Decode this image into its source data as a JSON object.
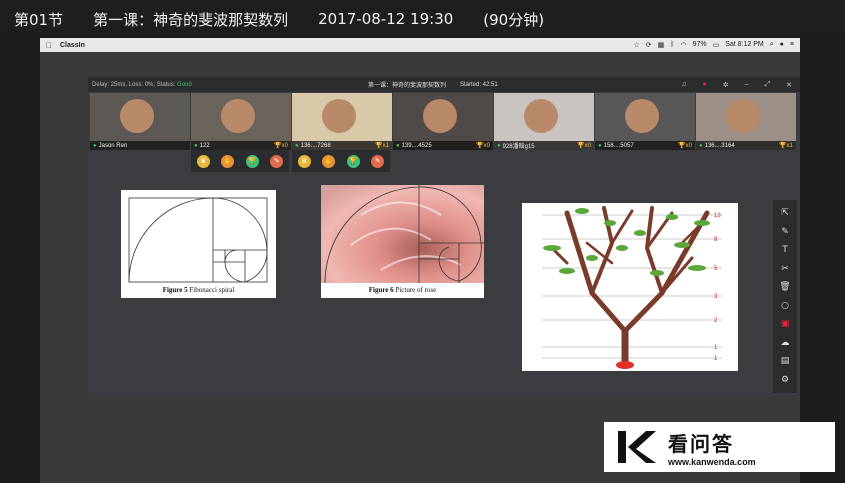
{
  "banner": {
    "lesson_no": "第01节",
    "lesson_title": "第一课：神奇的斐波那契数列",
    "datetime": "2017-08-12 19:30",
    "duration": "(90分钟)"
  },
  "macbar": {
    "app_name": "ClassIn",
    "battery": "97%",
    "clock": "Sat 8:12 PM"
  },
  "classin": {
    "status_prefix": "Delay: 25ms, Loss: 0%, Status: ",
    "status_value": "Good",
    "title": "第一课：神奇的斐波那契数列",
    "started": "Started: 42:51"
  },
  "videos": [
    {
      "name": "Jason Ren",
      "trophy": ""
    },
    {
      "name": "122",
      "trophy": "x0"
    },
    {
      "name": "136....7268",
      "trophy": "x1"
    },
    {
      "name": "139....4525",
      "trophy": "x0"
    },
    {
      "name": "928潘晗g15",
      "trophy": "x0"
    },
    {
      "name": "158....5057",
      "trophy": "x0"
    },
    {
      "name": "136....3164",
      "trophy": "x1"
    }
  ],
  "figures": {
    "fig5_label": "Figure 5",
    "fig5_text": " Fibonacci spiral",
    "fig6_label": "Figure 6",
    "fig6_text": " Picture of rose",
    "tree_numbers": [
      "13",
      "8",
      "5",
      "3",
      "2",
      "1",
      "1"
    ]
  },
  "watermark": {
    "title": "看问答",
    "url": "www.kanwenda.com"
  },
  "colors": {
    "good": "#3fc45a",
    "trophy": "#e8c34a",
    "record": "#e22233"
  }
}
